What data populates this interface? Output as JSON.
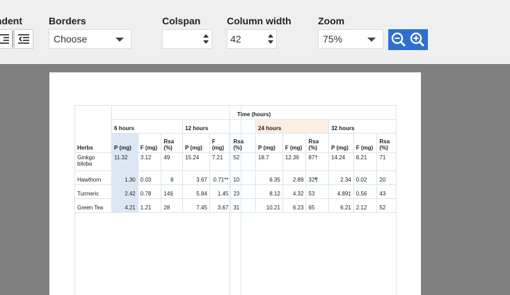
{
  "toolbar": {
    "indent_label": "Indent",
    "borders": {
      "label": "Borders",
      "value": "Choose"
    },
    "colspan": {
      "label": "Colspan",
      "value": ""
    },
    "column_width": {
      "label": "Column width",
      "value": "42"
    },
    "zoom": {
      "label": "Zoom",
      "value": "75%"
    },
    "accent_color": "#2f6fd1"
  },
  "table": {
    "caption_header": "Time (hours)",
    "row_header": "Herbs",
    "groups": [
      "6 hours",
      "12 hours",
      "24 hours",
      "32 hours"
    ],
    "subheaders": [
      "P (mg)",
      "F (mg)",
      "Rsa (%)"
    ],
    "rows": [
      {
        "herb": "Ginkgo biloba",
        "cells": [
          "11.32",
          "3.12",
          "49",
          "15.24",
          "7.21",
          "52",
          "18.7",
          "12.36",
          "87†",
          "14.24",
          "8.21",
          "71"
        ]
      },
      {
        "herb": "Hawthorn",
        "cells": [
          "1.30",
          "0.03",
          "8",
          "3.67",
          "0.71**",
          "10",
          "6.35",
          "2.89",
          "32¶",
          "2.34",
          "0.02",
          "20"
        ]
      },
      {
        "herb": "Turmeric",
        "cells": [
          "2.42",
          "0.78",
          "14§",
          "5.84",
          "1.45",
          "23",
          "8.12",
          "4.32",
          "53",
          "4.89‡",
          "0.56",
          "43"
        ]
      },
      {
        "herb": "Green Tea",
        "cells": [
          "4.21",
          "1.21",
          "28",
          "7.45",
          "3.67",
          "31",
          "10.21",
          "6.23",
          "65",
          "6.21",
          "2.12",
          "52"
        ]
      }
    ]
  }
}
